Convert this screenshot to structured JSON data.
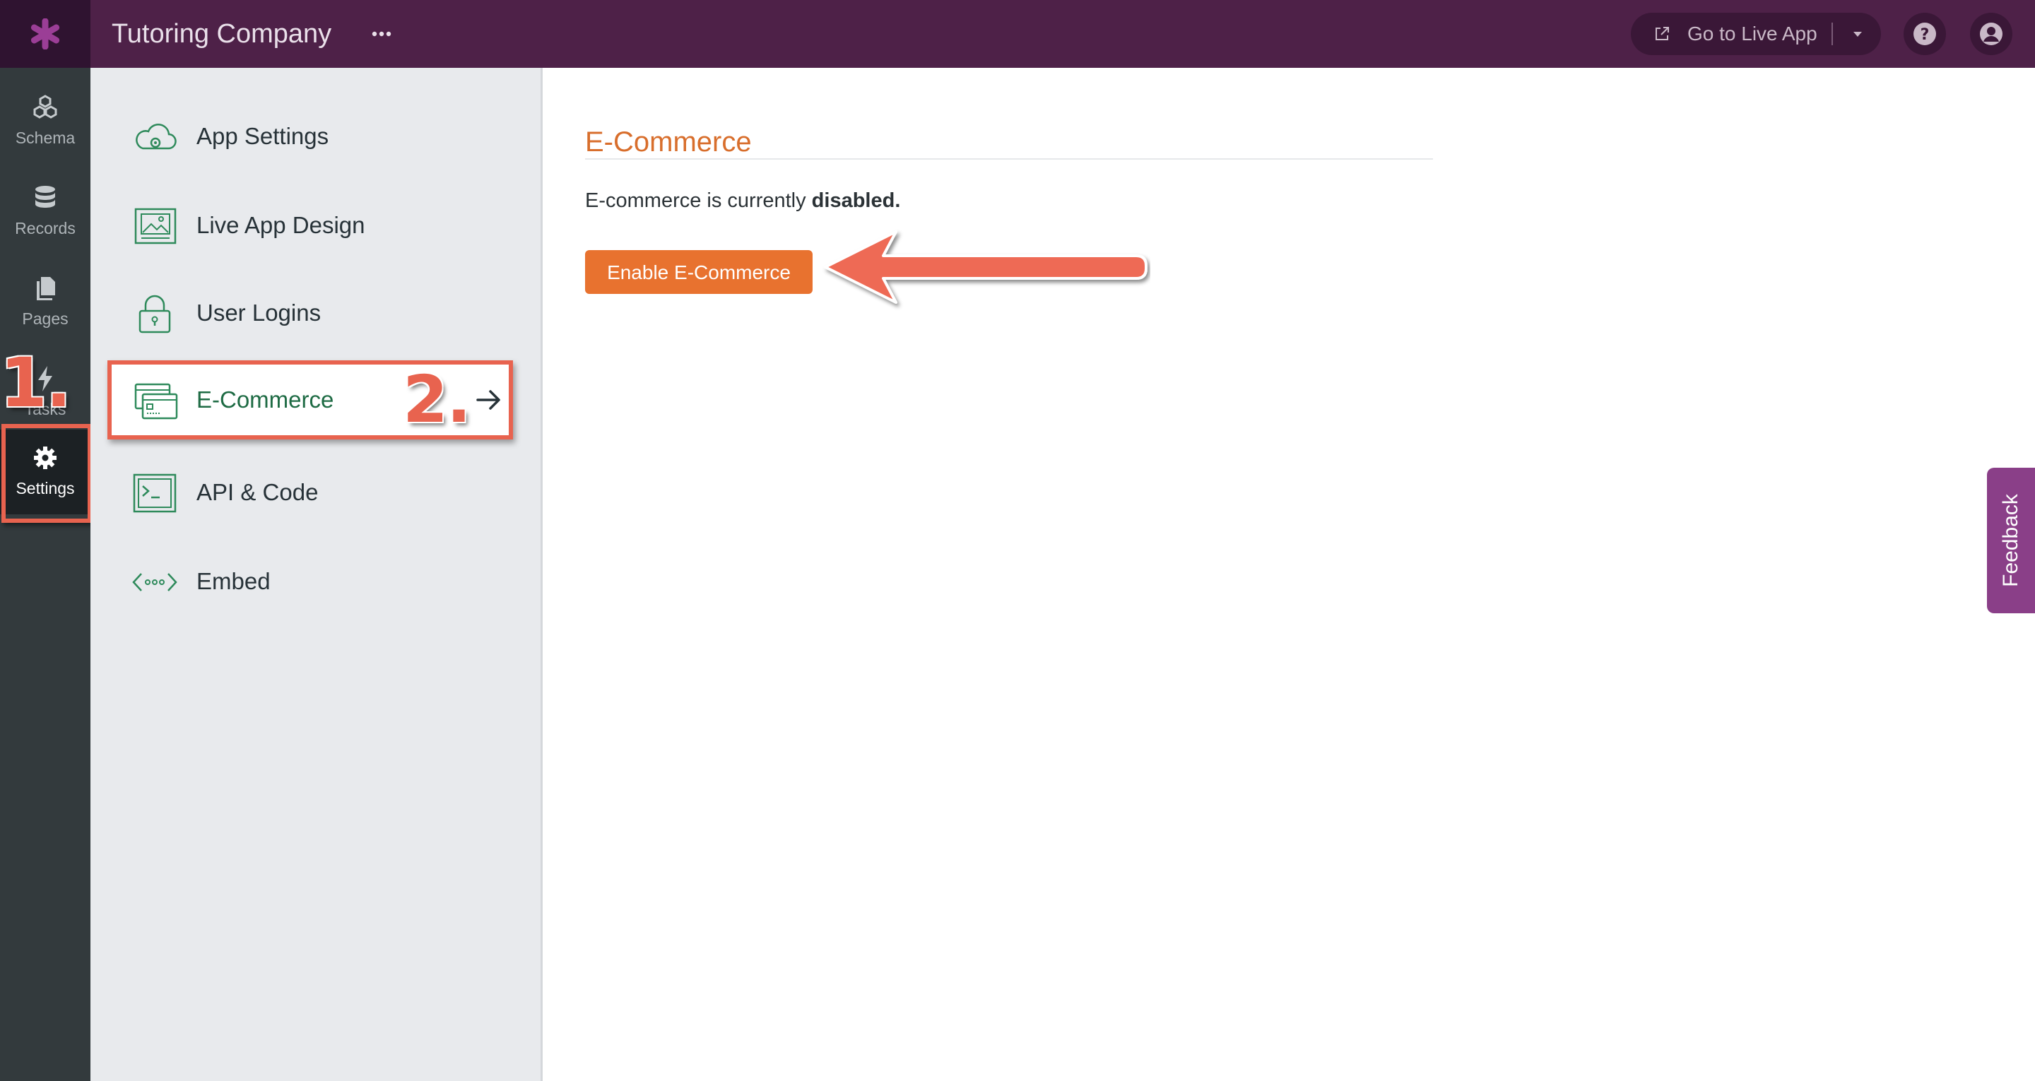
{
  "header": {
    "app_title": "Tutoring Company",
    "more_icon": "ellipsis-icon",
    "go_live_label": "Go to Live App",
    "colors": {
      "bar": "#4e2148",
      "logo_bg": "#2f1330",
      "logo": "#9b3e96"
    }
  },
  "rail": {
    "items": [
      {
        "label": "Schema",
        "icon": "cubes-icon"
      },
      {
        "label": "Records",
        "icon": "database-icon"
      },
      {
        "label": "Pages",
        "icon": "pages-icon"
      },
      {
        "label": "Tasks",
        "icon": "bolt-icon"
      },
      {
        "label": "Settings",
        "icon": "gear-icon"
      }
    ],
    "active": "Settings"
  },
  "settings_menu": {
    "items": [
      {
        "label": "App Settings",
        "icon": "cloud-gear-icon"
      },
      {
        "label": "Live App Design",
        "icon": "image-icon"
      },
      {
        "label": "User Logins",
        "icon": "lock-icon"
      },
      {
        "label": "E-Commerce",
        "icon": "credit-card-icon"
      },
      {
        "label": "API & Code",
        "icon": "terminal-icon"
      },
      {
        "label": "Embed",
        "icon": "embed-icon"
      }
    ],
    "active": "E-Commerce"
  },
  "main": {
    "title": "E-Commerce",
    "status_prefix": "E-commerce is currently ",
    "status_value": "disabled.",
    "enable_button": "Enable E-Commerce"
  },
  "annotations": {
    "step1": "1.",
    "step2": "2.",
    "color": "#e8634f"
  },
  "feedback_label": "Feedback"
}
